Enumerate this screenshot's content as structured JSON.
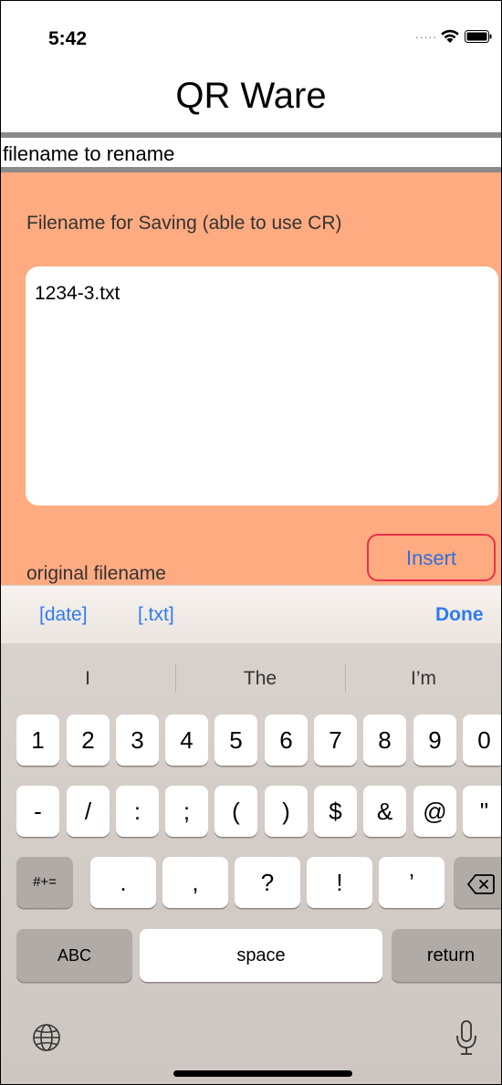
{
  "status_bar": {
    "time": "5:42",
    "signal": "....."
  },
  "app": {
    "title": "QR Ware"
  },
  "rename_field": {
    "text": "filename to rename"
  },
  "panel": {
    "label": "Filename for Saving (able to use CR)",
    "text_value": "1234-3.txt",
    "original_label": "original filename",
    "insert_label": "Insert"
  },
  "accessory": {
    "date_label": "[date]",
    "txt_label": "[.txt]",
    "done_label": "Done"
  },
  "keyboard": {
    "suggestions": [
      "I",
      "The",
      "I’m"
    ],
    "number_row": [
      "1",
      "2",
      "3",
      "4",
      "5",
      "6",
      "7",
      "8",
      "9",
      "0"
    ],
    "symbol_row": [
      "-",
      "/",
      ":",
      ";",
      "(",
      ")",
      "$",
      "&",
      "@",
      "\""
    ],
    "third_row": {
      "more_label": "#+=",
      "keys": [
        ".",
        ",",
        "?",
        "!",
        "’"
      ]
    },
    "abc_label": "ABC",
    "space_label": "space",
    "return_label": "return"
  },
  "colors": {
    "panel": "#ffab81",
    "accent": "#2f7bf0",
    "insert_border": "#e8324a"
  }
}
